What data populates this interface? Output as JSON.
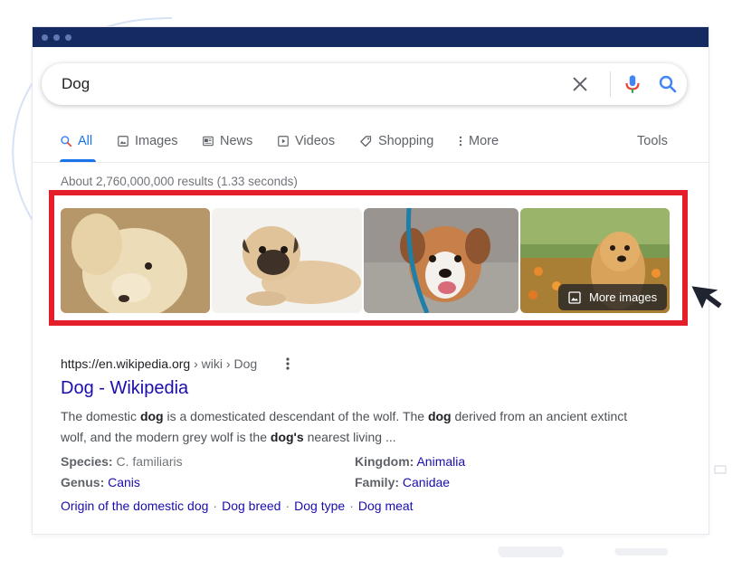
{
  "search": {
    "query": "Dog"
  },
  "tabs": [
    {
      "label": "All",
      "icon": "search-icon",
      "active": true
    },
    {
      "label": "Images",
      "icon": "image-icon"
    },
    {
      "label": "News",
      "icon": "news-icon"
    },
    {
      "label": "Videos",
      "icon": "video-icon"
    },
    {
      "label": "Shopping",
      "icon": "tag-icon"
    },
    {
      "label": "More",
      "icon": "more-vert-icon"
    }
  ],
  "tools_label": "Tools",
  "results_stats": "About 2,760,000,000 results (1.33 seconds)",
  "image_pack": {
    "thumbnails": [
      {
        "subject": "labrador puppy close-up"
      },
      {
        "subject": "pug puppy lying down"
      },
      {
        "subject": "beagle mix with leash"
      },
      {
        "subject": "golden retriever puppy in flowers"
      }
    ],
    "more_label": "More images"
  },
  "result": {
    "url": "https://en.wikipedia.org",
    "path1": "wiki",
    "path2": "Dog",
    "sep": "›",
    "title": "Dog - Wikipedia",
    "snippet": {
      "p1": "The domestic ",
      "b1": "dog",
      "p2": " is a domesticated descendant of the wolf. The ",
      "b2": "dog",
      "p3": " derived from an ancient extinct wolf, and the modern grey wolf is the ",
      "b3": "dog's",
      "p4": " nearest living ..."
    },
    "facts": {
      "species_label": "Species:",
      "species_value": "C. familiaris",
      "genus_label": "Genus:",
      "genus_value": "Canis",
      "kingdom_label": "Kingdom:",
      "kingdom_value": "Animalia",
      "family_label": "Family:",
      "family_value": "Canidae"
    },
    "sitelinks": [
      "Origin of the domestic dog",
      "Dog breed",
      "Dog type",
      "Dog meat"
    ],
    "sitelink_sep": "·"
  },
  "colors": {
    "titlebar": "#152a61",
    "highlight": "#e41e2b",
    "link": "#1a0dab",
    "accent": "#1a73e8"
  }
}
